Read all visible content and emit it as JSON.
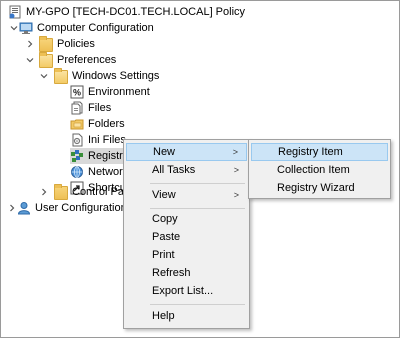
{
  "tree": {
    "root": "MY-GPO [TECH-DC01.TECH.LOCAL] Policy",
    "computer_configuration": "Computer Configuration",
    "policies": "Policies",
    "preferences": "Preferences",
    "windows_settings": "Windows Settings",
    "environment": "Environment",
    "files": "Files",
    "folders": "Folders",
    "ini_files": "Ini Files",
    "registry": "Registry",
    "network": "Networl",
    "shortcuts": "Shortcu",
    "control_panel": "Control Par",
    "user_configuration": "User Configuration"
  },
  "context_menu": {
    "new": "New",
    "all_tasks": "All Tasks",
    "view": "View",
    "copy": "Copy",
    "paste": "Paste",
    "print": "Print",
    "refresh": "Refresh",
    "export_list": "Export List...",
    "help": "Help",
    "submenu_arrow": ">"
  },
  "submenu": {
    "registry_item": "Registry Item",
    "collection_item": "Collection Item",
    "registry_wizard": "Registry Wizard"
  },
  "colors": {
    "highlight": "#cce4f7",
    "highlight_border": "#99c9ef",
    "menu_bg": "#f0f0f0",
    "folder": "#eec055"
  }
}
